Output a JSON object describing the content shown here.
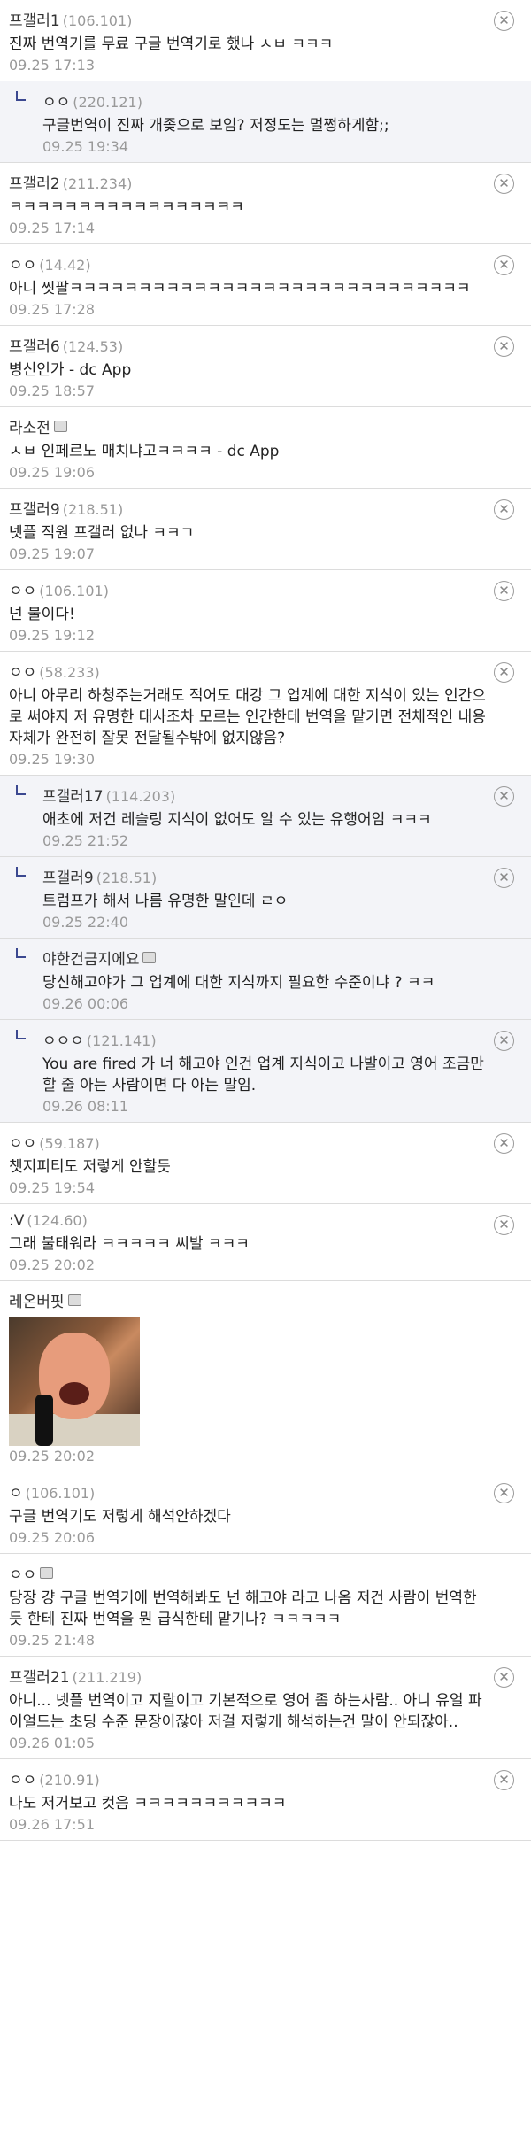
{
  "comments": [
    {
      "nick": "프갤러1",
      "ip": "(106.101)",
      "body": "진짜 번역기를 무료 구글 번역기로 했나 ㅅㅂ ㅋㅋㅋ",
      "date": "09.25 17:13",
      "reply": false,
      "deletable": true
    },
    {
      "nick": "ㅇㅇ",
      "ip": "(220.121)",
      "body": "구글번역이 진짜 개좆으로 보임? 저정도는 멀쩡하게함;;",
      "date": "09.25 19:34",
      "reply": true,
      "deletable": false
    },
    {
      "nick": "프갤러2",
      "ip": "(211.234)",
      "body": "ㅋㅋㅋㅋㅋㅋㅋㅋㅋㅋㅋㅋㅋㅋㅋㅋㅋ",
      "date": "09.25 17:14",
      "reply": false,
      "deletable": true
    },
    {
      "nick": "ㅇㅇ",
      "ip": "(14.42)",
      "body": "아니 씻팔ㅋㅋㅋㅋㅋㅋㅋㅋㅋㅋㅋㅋㅋㅋㅋㅋㅋㅋㅋㅋㅋㅋㅋㅋㅋㅋㅋㅋㅋ",
      "date": "09.25 17:28",
      "reply": false,
      "deletable": true
    },
    {
      "nick": "프갤러6",
      "ip": "(124.53)",
      "body": "병신인가 - dc App",
      "date": "09.25 18:57",
      "reply": false,
      "deletable": true
    },
    {
      "nick": "라소전",
      "ip": "",
      "badge": true,
      "body": "ㅅㅂ 인페르노 매치냐고ㅋㅋㅋㅋ - dc App",
      "date": "09.25 19:06",
      "reply": false,
      "deletable": false
    },
    {
      "nick": "프갤러9",
      "ip": "(218.51)",
      "body": "넷플 직원 프갤러 없나 ㅋㅋㄱ",
      "date": "09.25 19:07",
      "reply": false,
      "deletable": true
    },
    {
      "nick": "ㅇㅇ",
      "ip": "(106.101)",
      "body": "넌 불이다!",
      "date": "09.25 19:12",
      "reply": false,
      "deletable": true
    },
    {
      "nick": "ㅇㅇ",
      "ip": "(58.233)",
      "body": "아니 아무리 하청주는거래도 적어도 대강 그 업계에 대한 지식이 있는 인간으로 써야지 저 유명한 대사조차 모르는 인간한테 번역을 맡기면 전체적인 내용 자체가 완전히 잘못 전달될수밖에 없지않음?",
      "date": "09.25 19:30",
      "reply": false,
      "deletable": true
    },
    {
      "nick": "프갤러17",
      "ip": "(114.203)",
      "body": "애초에 저건 레슬링 지식이 없어도 알 수 있는 유행어임 ㅋㅋㅋ",
      "date": "09.25 21:52",
      "reply": true,
      "deletable": true
    },
    {
      "nick": "프갤러9",
      "ip": "(218.51)",
      "body": "트럼프가 해서 나름 유명한 말인데 ㄹㅇ",
      "date": "09.25 22:40",
      "reply": true,
      "deletable": true
    },
    {
      "nick": "야한건금지에요",
      "ip": "",
      "badge": true,
      "body": "당신해고야가 그 업계에 대한 지식까지 필요한 수준이냐 ? ㅋㅋ",
      "date": "09.26 00:06",
      "reply": true,
      "deletable": false
    },
    {
      "nick": "ㅇㅇㅇ",
      "ip": "(121.141)",
      "body": "You are fired 가 너 해고야 인건 업계 지식이고 나발이고 영어 조금만 할 줄 아는 사람이면 다 아는 말임.",
      "date": "09.26 08:11",
      "reply": true,
      "deletable": true
    },
    {
      "nick": "ㅇㅇ",
      "ip": "(59.187)",
      "body": "챗지피티도 저렇게 안할듯",
      "date": "09.25 19:54",
      "reply": false,
      "deletable": true
    },
    {
      "nick": ":V",
      "ip": "(124.60)",
      "body": "그래 불태워라 ㅋㅋㅋㅋㅋ 씨발 ㅋㅋㅋ",
      "date": "09.25 20:02",
      "reply": false,
      "deletable": true
    },
    {
      "nick": "레온버핏",
      "ip": "",
      "badge": true,
      "body": "",
      "image": true,
      "date": "09.25 20:02",
      "reply": false,
      "deletable": false
    },
    {
      "nick": "ㅇ",
      "ip": "(106.101)",
      "body": "구글 번역기도 저렇게 해석안하겠다",
      "date": "09.25 20:06",
      "reply": false,
      "deletable": true
    },
    {
      "nick": "ㅇㅇ",
      "ip": "",
      "badge": true,
      "body": "당장 걍 구글 번역기에 번역해봐도 넌 해고야 라고 나옴 저건 사람이 번역한 듯 한테 진짜 번역을 뭔 급식한테 맡기나? ㅋㅋㅋㅋㅋ",
      "date": "09.25 21:48",
      "reply": false,
      "deletable": false
    },
    {
      "nick": "프갤러21",
      "ip": "(211.219)",
      "body": "아니... 넷플 번역이고 지랄이고 기본적으로 영어 좀 하는사람.. 아니 유얼 파이얼드는 초딩 수준 문장이잖아 저걸 저렇게 해석하는건 말이 안되잖아..",
      "date": "09.26 01:05",
      "reply": false,
      "deletable": true
    },
    {
      "nick": "ㅇㅇ",
      "ip": "(210.91)",
      "body": "나도 저거보고 컷음 ㅋㅋㅋㅋㅋㅋㅋㅋㅋㅋㅋ",
      "date": "09.26 17:51",
      "reply": false,
      "deletable": true
    }
  ],
  "icons": {
    "delete": "close-circle-icon",
    "badge": "gallery-badge-icon",
    "reply": "reply-arrow-icon"
  },
  "colors": {
    "reply_bg": "#f3f4f8",
    "reply_arrow": "#3b4890",
    "meta": "#999999"
  }
}
